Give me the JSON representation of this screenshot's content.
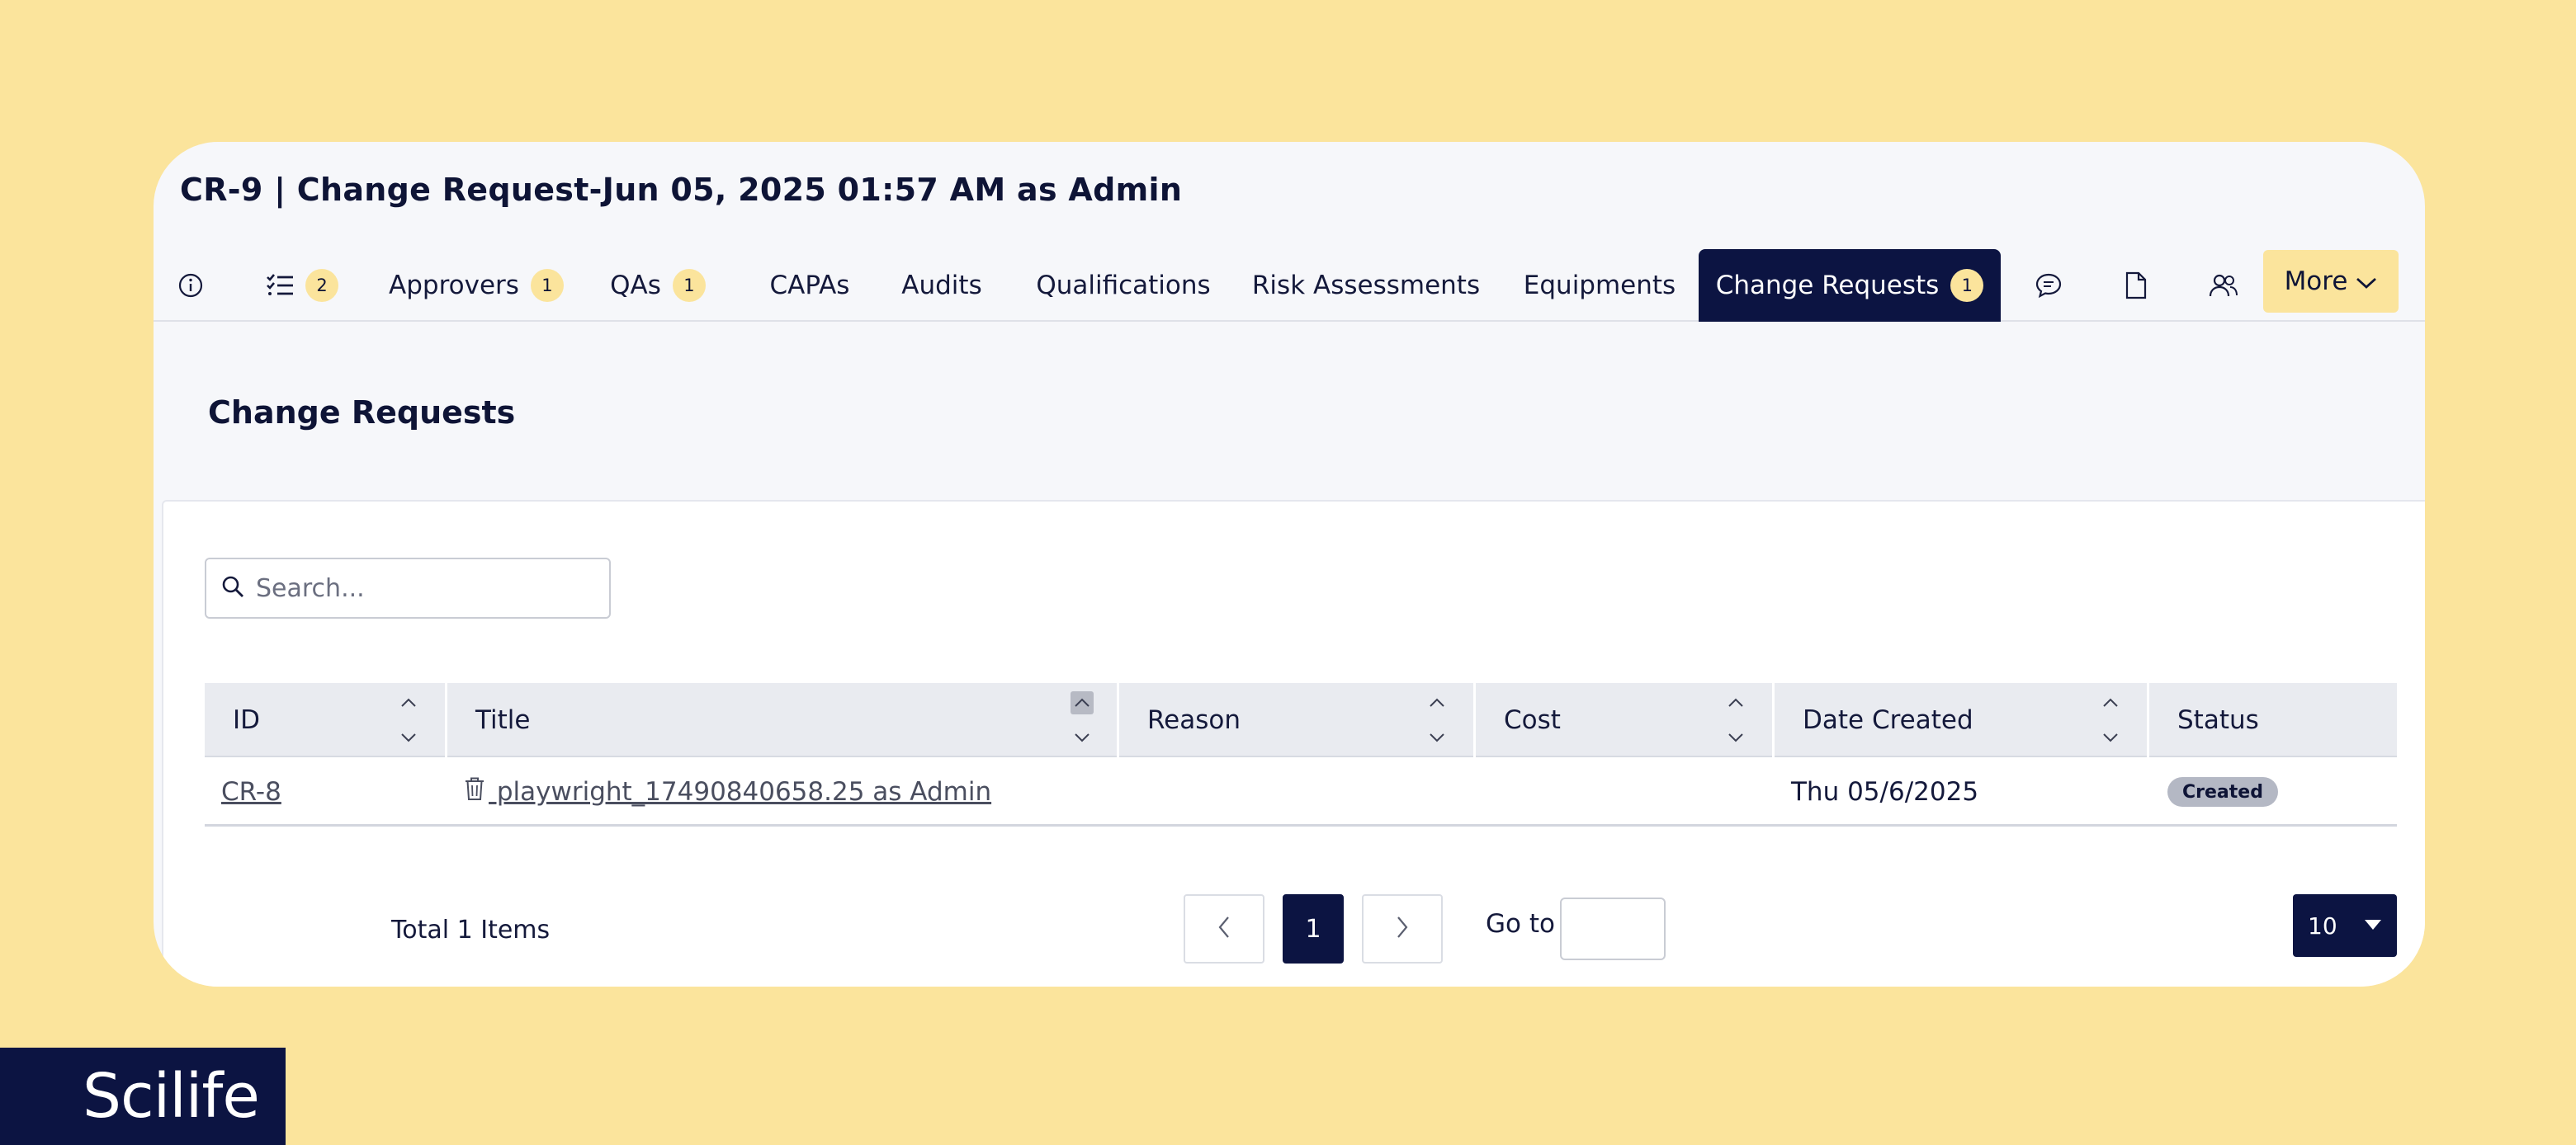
{
  "header": {
    "title": "CR-9  |  Change Request-Jun 05, 2025 01:57 AM as Admin"
  },
  "tabs": [
    {
      "id": "info",
      "icon": "info-icon",
      "label": "",
      "badge": ""
    },
    {
      "id": "checklist",
      "icon": "checklist-icon",
      "label": "",
      "badge": "2"
    },
    {
      "id": "approvers",
      "label": "Approvers",
      "badge": "1"
    },
    {
      "id": "qas",
      "label": "QAs",
      "badge": "1"
    },
    {
      "id": "capas",
      "label": "CAPAs",
      "badge": ""
    },
    {
      "id": "audits",
      "label": "Audits",
      "badge": ""
    },
    {
      "id": "qualifications",
      "label": "Qualifications",
      "badge": ""
    },
    {
      "id": "risk",
      "label": "Risk Assessments",
      "badge": ""
    },
    {
      "id": "equipments",
      "label": "Equipments",
      "badge": ""
    },
    {
      "id": "change-requests",
      "label": "Change Requests",
      "badge": "1",
      "active": true
    },
    {
      "id": "comments",
      "icon": "comment-icon",
      "label": "",
      "badge": ""
    },
    {
      "id": "documents",
      "icon": "document-icon",
      "label": "",
      "badge": ""
    },
    {
      "id": "users",
      "icon": "users-icon",
      "label": "",
      "badge": ""
    }
  ],
  "more_label": "More",
  "section_title": "Change Requests",
  "search": {
    "placeholder": "Search...",
    "value": ""
  },
  "table": {
    "columns": [
      "ID",
      "Title",
      "Reason",
      "Cost",
      "Date Created",
      "Status"
    ],
    "rows": [
      {
        "id": "CR-8",
        "title": " playwright_17490840658.25 as Admin",
        "reason": "",
        "cost": "",
        "date_created": "Thu 05/6/2025",
        "status": "Created"
      }
    ]
  },
  "pagination": {
    "total_label": "Total 1 Items",
    "current_page": "1",
    "goto_label": "Go to",
    "goto_value": "",
    "page_size": "10"
  },
  "brand": {
    "logo_text": "Scilife",
    "colors": {
      "accent": "#fbe49c",
      "navy": "#0c1442"
    }
  }
}
